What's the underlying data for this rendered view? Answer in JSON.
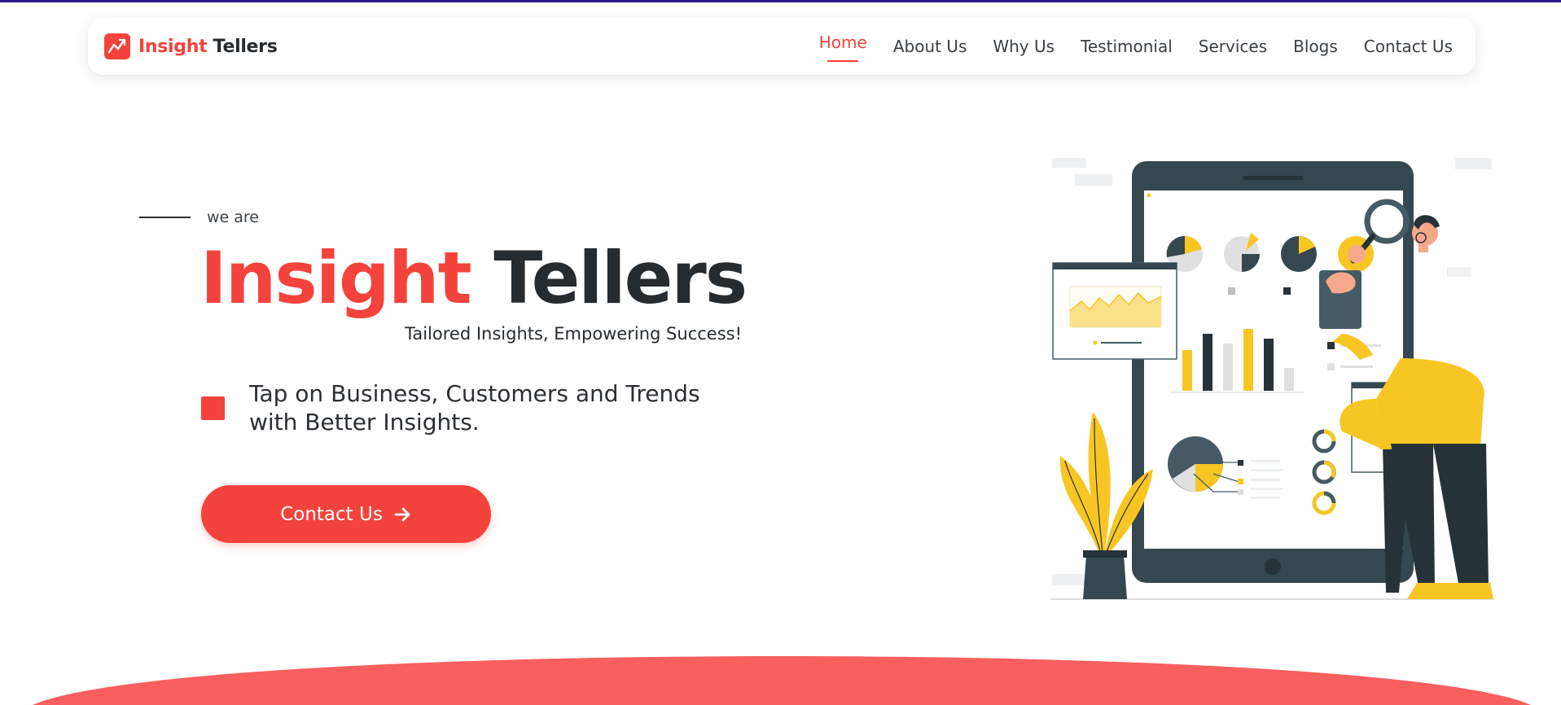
{
  "window": {
    "accent_color": "#f4433c",
    "dark_color": "#262b2f",
    "top_bar_color": "#2a1b8f"
  },
  "brand": {
    "logo_icon": "line-chart-icon",
    "name_red": "Insight",
    "name_dark": "Tellers"
  },
  "nav": {
    "items": [
      {
        "label": "Home",
        "active": true
      },
      {
        "label": "About Us",
        "active": false
      },
      {
        "label": "Why Us",
        "active": false
      },
      {
        "label": "Testimonial",
        "active": false
      },
      {
        "label": "Services",
        "active": false
      },
      {
        "label": "Blogs",
        "active": false
      },
      {
        "label": "Contact Us",
        "active": false
      }
    ]
  },
  "hero": {
    "eyebrow": "we are",
    "title_red": "Insight",
    "title_dark": "Tellers",
    "tagline": "Tailored Insights, Empowering Success!",
    "feature_line1": "Tap on Business, Customers and Trends",
    "feature_line2": "with Better Insights.",
    "cta_label": "Contact Us",
    "cta_icon": "arrow-right-icon"
  },
  "illustration": {
    "subject": "man-with-magnifier-and-dashboard",
    "highlight_color": "#f8c623",
    "panel_color": "#37474f"
  }
}
